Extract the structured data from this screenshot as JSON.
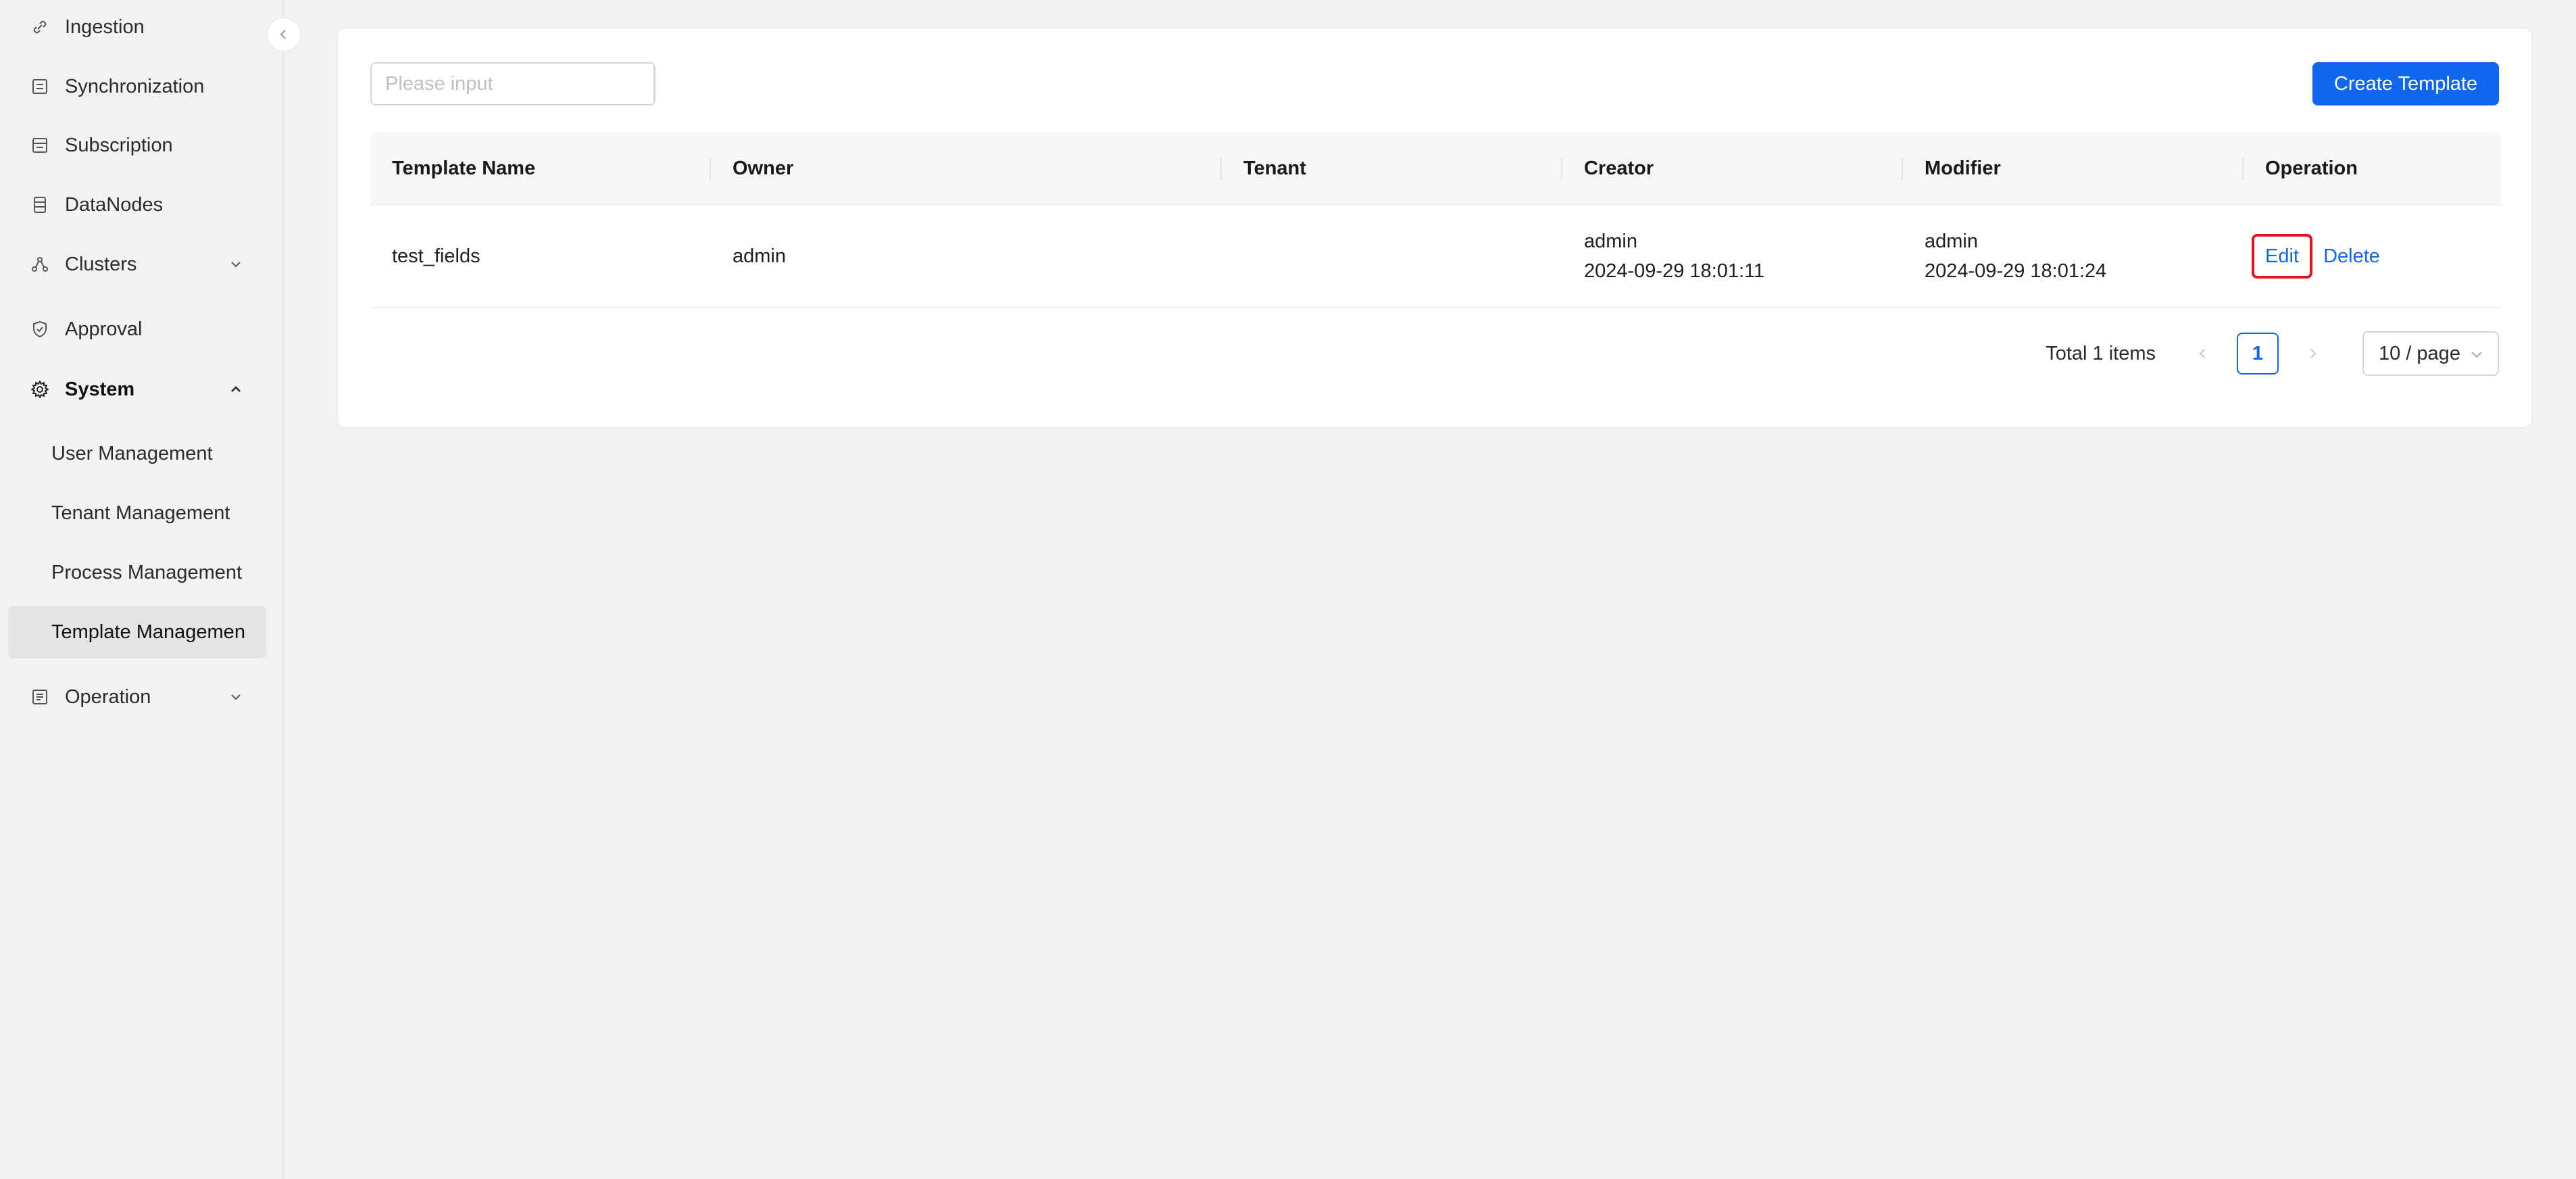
{
  "sidebar": {
    "items": [
      {
        "label": "Ingestion",
        "icon": "link-icon"
      },
      {
        "label": "Synchronization",
        "icon": "sync-icon"
      },
      {
        "label": "Subscription",
        "icon": "subscription-icon"
      },
      {
        "label": "DataNodes",
        "icon": "datanode-icon"
      },
      {
        "label": "Clusters",
        "icon": "cluster-icon"
      },
      {
        "label": "Approval",
        "icon": "shield-check-icon"
      },
      {
        "label": "System",
        "icon": "gear-icon"
      },
      {
        "label": "Operation",
        "icon": "operation-icon"
      }
    ],
    "system_children": [
      {
        "label": "User Management"
      },
      {
        "label": "Tenant Management"
      },
      {
        "label": "Process Management"
      },
      {
        "label": "Template Managemen"
      }
    ]
  },
  "toolbar": {
    "search_placeholder": "Please input",
    "create_label": "Create Template"
  },
  "table": {
    "columns": [
      "Template Name",
      "Owner",
      "Tenant",
      "Creator",
      "Modifier",
      "Operation"
    ],
    "rows": [
      {
        "name": "test_fields",
        "owner": "admin",
        "tenant": "",
        "creator": "admin",
        "created_at": "2024-09-29 18:01:11",
        "modifier": "admin",
        "modified_at": "2024-09-29 18:01:24",
        "edit_label": "Edit",
        "delete_label": "Delete"
      }
    ]
  },
  "pagination": {
    "total": "Total 1 items",
    "current": "1",
    "page_size": "10 / page"
  },
  "colors": {
    "primary": "#1166ee",
    "highlight": "#e0141e"
  }
}
